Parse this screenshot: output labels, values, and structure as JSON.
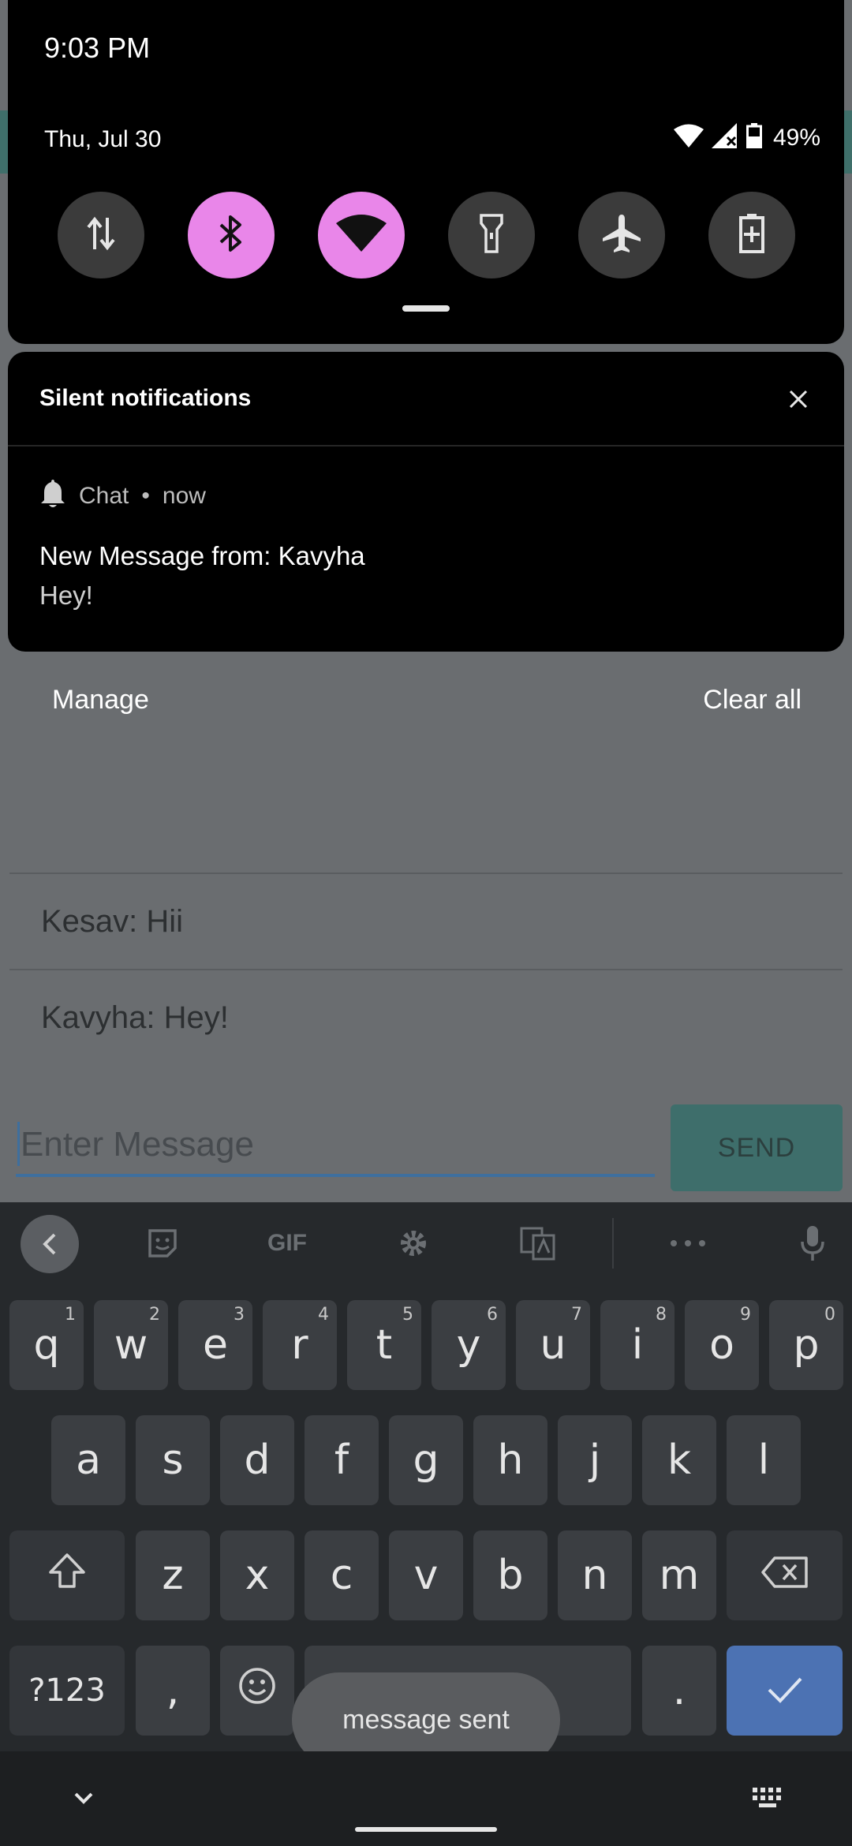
{
  "status": {
    "time": "9:03 PM",
    "date": "Thu, Jul 30",
    "battery": "49%"
  },
  "quick_settings": [
    {
      "name": "mobile-data",
      "icon": "arrows-updown-icon",
      "active": false
    },
    {
      "name": "bluetooth",
      "icon": "bluetooth-icon",
      "active": true
    },
    {
      "name": "wifi",
      "icon": "wifi-icon",
      "active": true
    },
    {
      "name": "flashlight",
      "icon": "flashlight-icon",
      "active": false
    },
    {
      "name": "airplane-mode",
      "icon": "airplane-icon",
      "active": false
    },
    {
      "name": "battery-saver",
      "icon": "battery-saver-icon",
      "active": false
    }
  ],
  "notifications": {
    "section_title": "Silent notifications",
    "app_name": "Chat",
    "separator": "•",
    "time": "now",
    "title": "New Message from: Kavyha",
    "text": "Hey!"
  },
  "actions": {
    "manage": "Manage",
    "clear_all": "Clear all"
  },
  "chat": {
    "messages": [
      "Kesav: Hii",
      "Kavyha: Hey!"
    ],
    "input_placeholder": "Enter Message",
    "send_label": "SEND"
  },
  "keyboard": {
    "toolbar": {
      "gif": "GIF"
    },
    "row1": [
      {
        "k": "q",
        "h": "1"
      },
      {
        "k": "w",
        "h": "2"
      },
      {
        "k": "e",
        "h": "3"
      },
      {
        "k": "r",
        "h": "4"
      },
      {
        "k": "t",
        "h": "5"
      },
      {
        "k": "y",
        "h": "6"
      },
      {
        "k": "u",
        "h": "7"
      },
      {
        "k": "i",
        "h": "8"
      },
      {
        "k": "o",
        "h": "9"
      },
      {
        "k": "p",
        "h": "0"
      }
    ],
    "row2": [
      "a",
      "s",
      "d",
      "f",
      "g",
      "h",
      "j",
      "k",
      "l"
    ],
    "row3": [
      "z",
      "x",
      "c",
      "v",
      "b",
      "n",
      "m"
    ],
    "symbols_label": "?123",
    "comma": ",",
    "period": "."
  },
  "toast": "message sent",
  "colors": {
    "tile_active": "#e986e9",
    "send_button": "#3e6e6b",
    "done_key": "#4c72b3"
  }
}
